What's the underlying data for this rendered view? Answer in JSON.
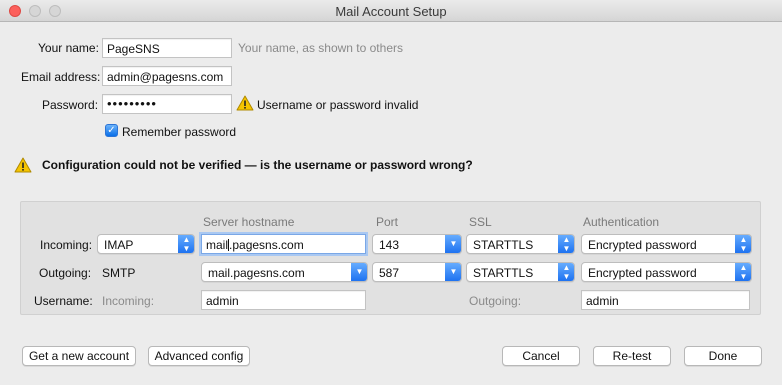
{
  "window": {
    "title": "Mail Account Setup"
  },
  "identity": {
    "name_label": "Your name:",
    "name_value": "PageSNS",
    "name_hint": "Your name, as shown to others",
    "email_label": "Email address:",
    "email_value": "admin@pagesns.com",
    "password_label": "Password:",
    "password_value": "•••••••••",
    "password_error": "Username or password invalid",
    "remember_label": "Remember password",
    "remember_checked": true
  },
  "alert": {
    "message": "Configuration could not be verified — is the username or password wrong?"
  },
  "server": {
    "headers": {
      "hostname": "Server hostname",
      "port": "Port",
      "ssl": "SSL",
      "auth": "Authentication"
    },
    "incoming": {
      "label": "Incoming:",
      "protocol": "IMAP",
      "hostname_before_cursor": "mail",
      "hostname_after_cursor": ".pagesns.com",
      "port": "143",
      "ssl": "STARTTLS",
      "auth": "Encrypted password"
    },
    "outgoing": {
      "label": "Outgoing:",
      "protocol": "SMTP",
      "hostname": "mail.pagesns.com",
      "port": "587",
      "ssl": "STARTTLS",
      "auth": "Encrypted password"
    },
    "username": {
      "label": "Username:",
      "incoming_label": "Incoming:",
      "incoming_value": "admin",
      "outgoing_label": "Outgoing:",
      "outgoing_value": "admin"
    }
  },
  "buttons": {
    "new_account": "Get a new account",
    "advanced": "Advanced config",
    "cancel": "Cancel",
    "retest": "Re-test",
    "done": "Done"
  },
  "icons": {
    "warning": "warning-icon",
    "checkbox": "checkmark-icon",
    "dropdown": "chevron-updown-icon"
  },
  "colors": {
    "accent": "#1a6ff0",
    "close": "#fc605c",
    "warning": "#f5c400"
  }
}
